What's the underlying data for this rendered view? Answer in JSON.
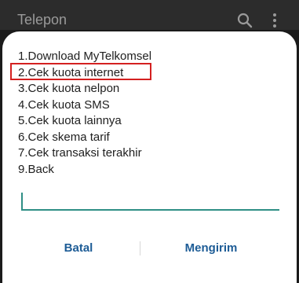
{
  "app": {
    "title": "Telepon",
    "icons": {
      "search": "search-icon",
      "more": "more-vertical-icon"
    }
  },
  "dialog": {
    "menu": [
      "1.Download MyTelkomsel",
      "2.Cek kuota internet",
      "3.Cek kuota nelpon",
      "4.Cek kuota SMS",
      "5.Cek kuota lainnya",
      "6.Cek skema tarif",
      "7.Cek transaksi terakhir",
      "9.Back"
    ],
    "highlighted_item": "2.Cek kuota internet",
    "input": {
      "value": ""
    },
    "buttons": {
      "cancel": "Batal",
      "send": "Mengirim"
    }
  },
  "colors": {
    "highlight_border": "#d42020",
    "input_underline": "#2f8f86",
    "button_text": "#1d5c96",
    "topbar_bg": "#2c2c2c"
  }
}
